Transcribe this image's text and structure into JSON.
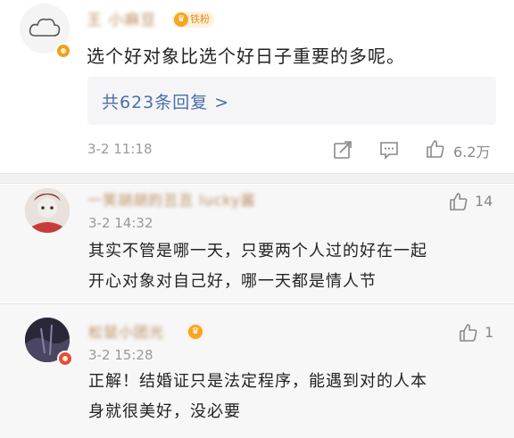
{
  "main": {
    "username": "王 小麻豆",
    "fan_badge": "铁粉",
    "text": "选个好对象比选个好日子重要的多呢。",
    "reply_link": "共623条回复 >",
    "time": "3-2 11:18",
    "like_count": "6.2万"
  },
  "replies": [
    {
      "username": "一笑胡胡的丑丑 lucky酱",
      "time": "3-2 14:32",
      "line1": "其实不管是哪一天，只要两个人过的好在一起",
      "line2": "开心对象对自己好，哪一天都是情人节",
      "like_count": "14"
    },
    {
      "username": "松鼠小团光",
      "time": "3-2 15:28",
      "line1": "正解！结婚证只是法定程序，能遇到对的人本",
      "line2": "身就很美好，没必要",
      "like_count": "1"
    }
  ],
  "icons": {
    "share": "share-icon",
    "comment": "comment-icon",
    "like": "thumbs-up-icon",
    "verified": "verified-badge-icon"
  },
  "colors": {
    "link": "#4a6fa5",
    "username": "#b98a5a",
    "badge": "#f5a623",
    "meta": "#9a9a9a"
  }
}
